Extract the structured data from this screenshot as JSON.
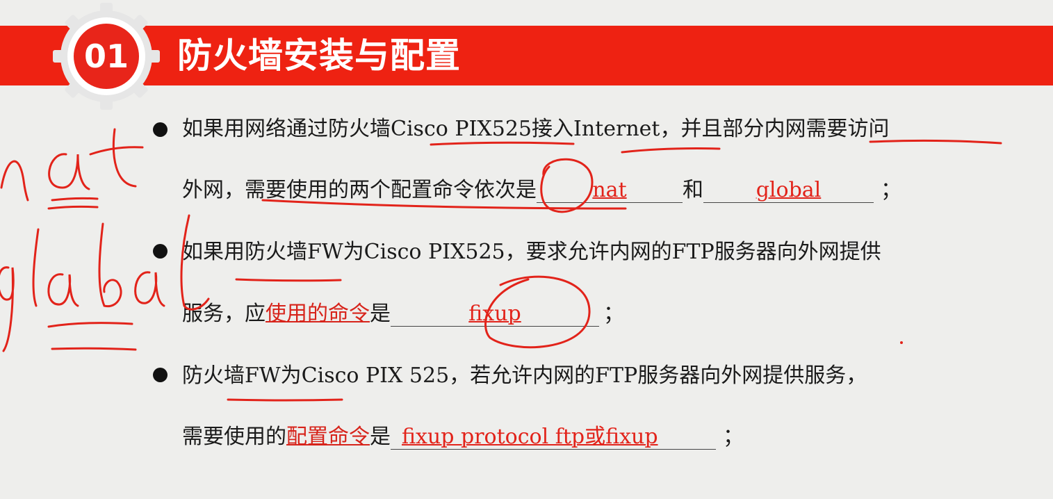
{
  "header": {
    "badge": "01",
    "title": "防火墙安装与配置"
  },
  "items": [
    {
      "line1": "如果用网络通过防火墙Cisco PIX525接入Internet，并且部分内网需要访问",
      "line2_pre": "外网，需要使用的两个配置命令依次是",
      "answer1": "nat",
      "conj": "和",
      "answer2": "global",
      "end": "；"
    },
    {
      "line1": "如果用防火墙FW为Cisco PIX525，要求允许内网的FTP服务器向外网提供",
      "line2_pre": "服务，应",
      "line2_mark": "使用的命令",
      "line2_post": "是",
      "answer": "fixup",
      "end": "；"
    },
    {
      "line1": "防火墙FW为Cisco PIX 525，若允许内网的FTP服务器向外网提供服务，",
      "line2_pre": "需要使用的",
      "line2_mark": "配置命令",
      "line2_post": "是",
      "answer": "fixup  protocol ftp或fixup",
      "end": "；"
    }
  ],
  "handwriting": [
    "nat",
    "global"
  ],
  "colors": {
    "banner": "#ee2212",
    "ink": "#e2231a",
    "background": "#eeeeec"
  }
}
